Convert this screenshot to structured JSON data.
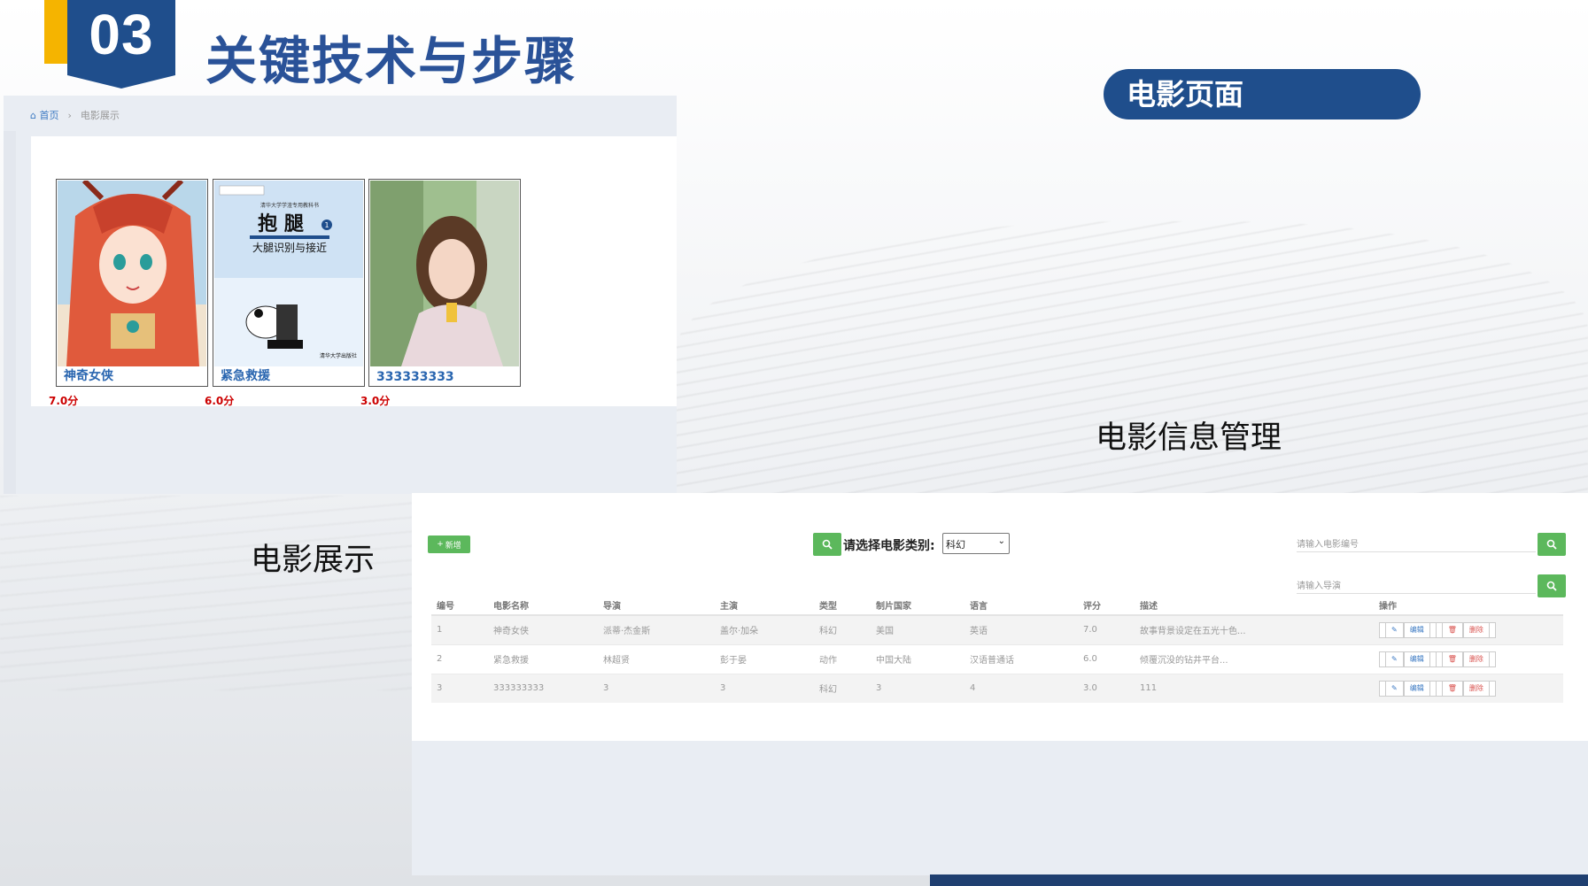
{
  "slide": {
    "number": "03",
    "title": "关键技术与步骤",
    "pill_label": "电影页面",
    "caption_management": "电影信息管理",
    "caption_display": "电影展示"
  },
  "display_page": {
    "breadcrumb": {
      "home": "首页",
      "current": "电影展示"
    },
    "movies": [
      {
        "name": "神奇女侠",
        "score": "7.0分",
        "poster": "anime-girl"
      },
      {
        "name": "紧急救援",
        "score": "6.0分",
        "poster": "textbook-panda"
      },
      {
        "name": "333333333",
        "score": "3.0分",
        "poster": "portrait-girl"
      }
    ],
    "poster2_text": {
      "top": "清华大学学渣专用教科书",
      "big": "抱 腿",
      "badge": "1",
      "sub": "大腿识别与接近",
      "publisher": "清华大学出版社"
    }
  },
  "management_page": {
    "add_label": "新增",
    "filter_label": "请选择电影类别:",
    "filter_value": "科幻",
    "search_id_placeholder": "请输入电影编号",
    "search_director_placeholder": "请输入导演",
    "columns": [
      "编号",
      "电影名称",
      "导演",
      "主演",
      "类型",
      "制片国家",
      "语言",
      "评分",
      "描述",
      "操作"
    ],
    "rows": [
      [
        "1",
        "神奇女侠",
        "派蒂·杰金斯",
        "盖尔·加朵",
        "科幻",
        "美国",
        "英语",
        "7.0",
        "故事背景设定在五光十色..."
      ],
      [
        "2",
        "紧急救援",
        "林超贤",
        "彭于晏",
        "动作",
        "中国大陆",
        "汉语普通话",
        "6.0",
        "倾覆沉没的钻井平台..."
      ],
      [
        "3",
        "333333333",
        "3",
        "3",
        "科幻",
        "3",
        "4",
        "3.0",
        "111"
      ]
    ],
    "edit_label": "编辑",
    "delete_label": "删除"
  },
  "colors": {
    "brand_blue": "#1f4e8c",
    "accent_yellow": "#f5b400",
    "green": "#5cb85c",
    "link_blue": "#2a66b0",
    "score_red": "#cc0000"
  }
}
